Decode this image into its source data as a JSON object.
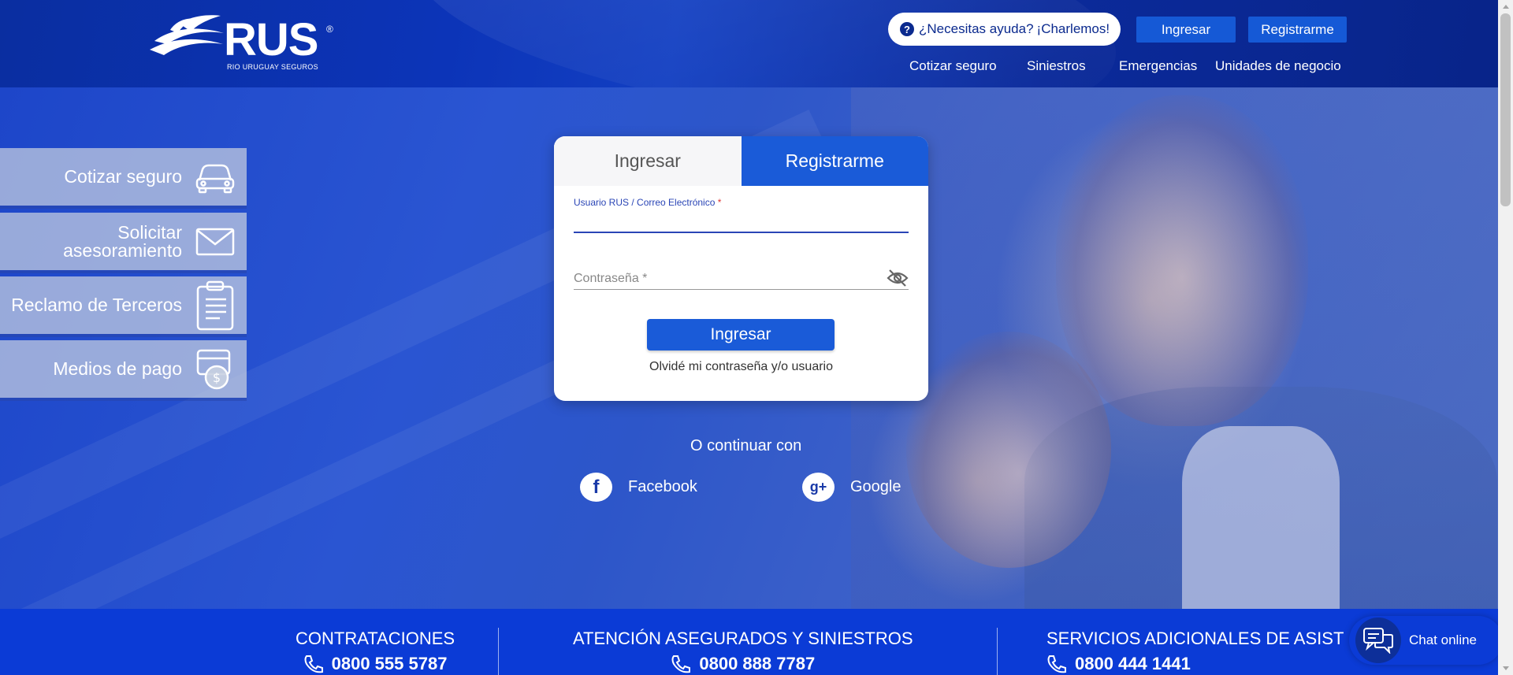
{
  "brand": {
    "name": "RUS",
    "registered": "®",
    "subtitle": "RIO URUGUAY SEGUROS"
  },
  "header": {
    "help_question": "¿Necesitas ayuda?",
    "help_cta": "¡Charlemos!",
    "login_label": "Ingresar",
    "register_label": "Registrarme",
    "nav": [
      "Cotizar seguro",
      "Siniestros",
      "Emergencias",
      "Unidades de negocio"
    ]
  },
  "side_menu": {
    "items": [
      {
        "label": "Cotizar seguro",
        "icon": "car-icon"
      },
      {
        "label": "Solicitar asesoramiento",
        "icon": "envelope-icon"
      },
      {
        "label": "Reclamo de Terceros",
        "icon": "clipboard-icon"
      },
      {
        "label": "Medios de pago",
        "icon": "wallet-icon"
      }
    ]
  },
  "login_card": {
    "tab_login": "Ingresar",
    "tab_register": "Registrarme",
    "active_tab": "Registrarme",
    "username_label": "Usuario RUS / Correo Electrónico",
    "required_mark": "*",
    "username_value": "",
    "password_label": "Contraseña *",
    "submit_label": "Ingresar",
    "forgot_label": "Olvidé mi contraseña y/o usuario"
  },
  "social": {
    "continue_label": "O continuar con",
    "facebook_label": "Facebook",
    "google_label": "Google"
  },
  "footer": {
    "columns": [
      {
        "title": "CONTRATACIONES",
        "phone": "0800 555 5787"
      },
      {
        "title": "ATENCIÓN ASEGURADOS Y SINIESTROS",
        "phone": "0800 888 7787"
      },
      {
        "title": "SERVICIOS ADICIONALES DE ASIST",
        "phone": "0800 444 1441"
      }
    ]
  },
  "chat": {
    "label": "Chat online"
  },
  "colors": {
    "primary": "#1a5bd8",
    "header": "#0a2ea0",
    "footer": "#0b3bd6",
    "accent_text": "#0b2a8e"
  }
}
